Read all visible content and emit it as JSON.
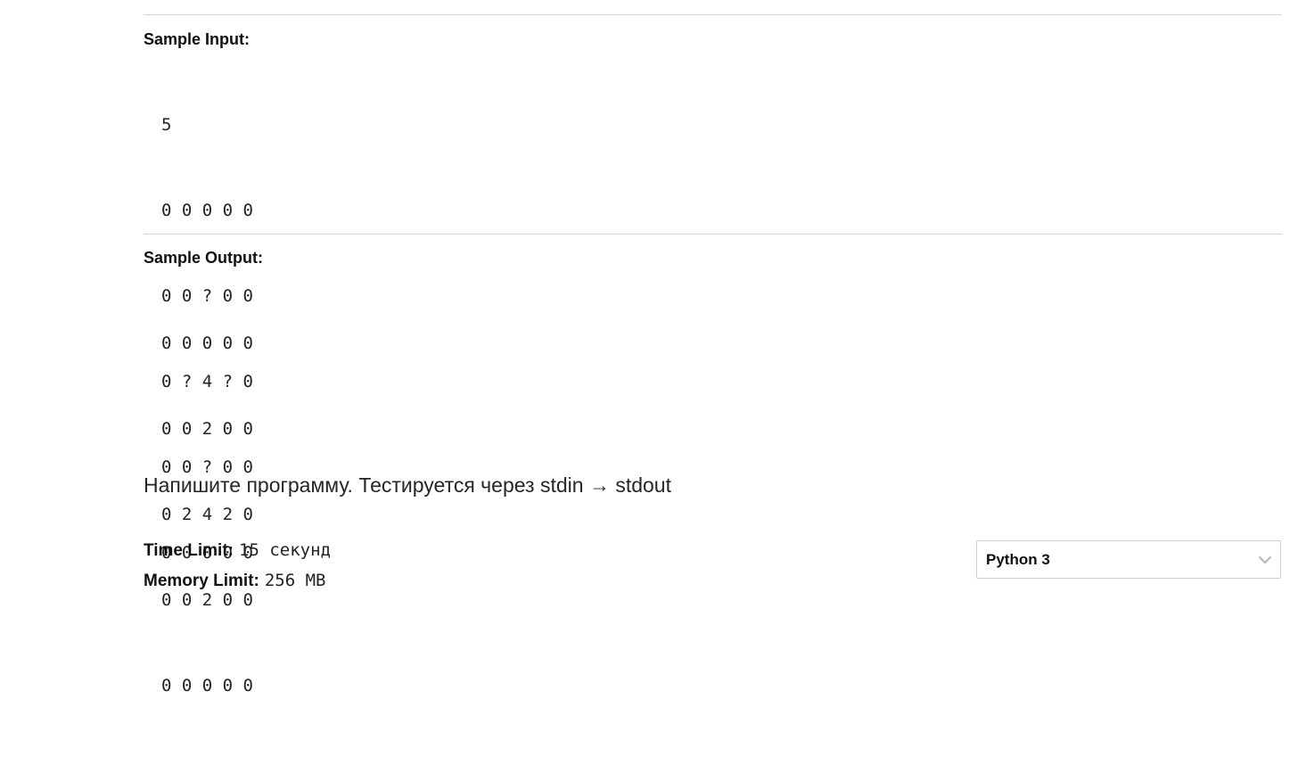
{
  "sample_input": {
    "heading": "Sample Input:",
    "lines": [
      "5",
      "0 0 0 0 0",
      "0 0 ? 0 0",
      "0 ? 4 ? 0",
      "0 0 ? 0 0",
      "0 0 0 0 0"
    ]
  },
  "sample_output": {
    "heading": "Sample Output:",
    "lines": [
      "0 0 0 0 0",
      "0 0 2 0 0",
      "0 2 4 2 0",
      "0 0 2 0 0",
      "0 0 0 0 0"
    ]
  },
  "task": {
    "title": "Напишите программу. Тестируется через stdin → stdout"
  },
  "limits": {
    "time_label": "Time Limit:",
    "time_value": "15 секунд",
    "memory_label": "Memory Limit:",
    "memory_value": "256 MB"
  },
  "language_select": {
    "selected": "Python 3",
    "icon": "chevron-down-icon"
  }
}
